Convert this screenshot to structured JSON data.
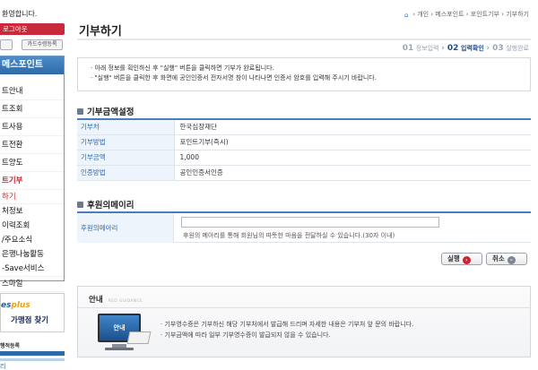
{
  "sidebar": {
    "welcome": "환영합니다.",
    "logout": "로그아웃",
    "card_btn": "카드수령등록",
    "panel_title": "메스포인트",
    "items": [
      {
        "label": "트안내",
        "state": "normal"
      },
      {
        "label": "트조회",
        "state": "normal"
      },
      {
        "label": "트사용",
        "state": "normal"
      },
      {
        "label": "트전환",
        "state": "normal"
      },
      {
        "label": "트양도",
        "state": "normal"
      },
      {
        "label": "트기부",
        "state": "active"
      },
      {
        "label": "하기",
        "state": "sub"
      },
      {
        "label": "처정보",
        "state": "plain"
      },
      {
        "label": "이력조회",
        "state": "plain"
      },
      {
        "label": "/주요소식",
        "state": "plain"
      },
      {
        "label": "은행나눔활동",
        "state": "plain"
      },
      {
        "label": "-Save서비스",
        "state": "tight"
      },
      {
        "label": "스마일",
        "state": "tight"
      }
    ],
    "banner_logo": "es",
    "banner_logo_plus": "plus",
    "banner_text": "가맹점 찾기",
    "status_label": "행적등록",
    "bottom_frag": "리"
  },
  "breadcrumb": {
    "home_icon": "home-icon",
    "text": "› 개인 › 메스포인트 › 포인트기부 › 기부하기"
  },
  "page": {
    "title": "기부하기"
  },
  "steps": [
    {
      "num": "01",
      "label": "정보입력",
      "current": false
    },
    {
      "num": "02",
      "label": "입력확인",
      "current": true
    },
    {
      "num": "03",
      "label": "실행완료",
      "current": false
    }
  ],
  "notice": {
    "lines": [
      "· 아래 정보를 확인하신 후 \"실행\" 버튼을 클릭하면 기부가 완료됩니다.",
      "· \"실행\" 버튼을 클릭한 후 화면에 공인인증서 전자서명 창이 나타나면 인증서 암호를 입력해 주시기 바랍니다."
    ]
  },
  "donation": {
    "section_title": "기부금액설정",
    "rows": [
      {
        "label": "기부처",
        "value": "한국심장재단"
      },
      {
        "label": "기부방법",
        "value": "포인트기부(즉시)"
      },
      {
        "label": "기부금액",
        "value": "1,000"
      },
      {
        "label": "인증방법",
        "value": "공인인증서인증"
      }
    ]
  },
  "memo": {
    "section_title": "후원의메이리",
    "label": "후원의메아리",
    "value": "",
    "help": "후원의 메아리를 통해 회원님의 따뜻한 마음을 전달하실 수 있습니다.(30자 이내)"
  },
  "buttons": {
    "execute": "실행",
    "cancel": "취소"
  },
  "guide": {
    "title": "안내",
    "subtitle": "RED GUIDANCE",
    "monitor_text": "안내",
    "lines": [
      "· 기부영수증은 기부하신 해당 기부처에서 발급해 드리며 자세한 내용은 기부처 앞 문의 바랍니다.",
      "· 기부금액에 따라 일부 기부영수증이 발급되지 않을 수 있습니다."
    ]
  },
  "colors": {
    "accent_blue": "#2d6aa8",
    "accent_red": "#c8293b",
    "label_blue": "#2d69b3",
    "label_bg": "#edf4fb"
  }
}
